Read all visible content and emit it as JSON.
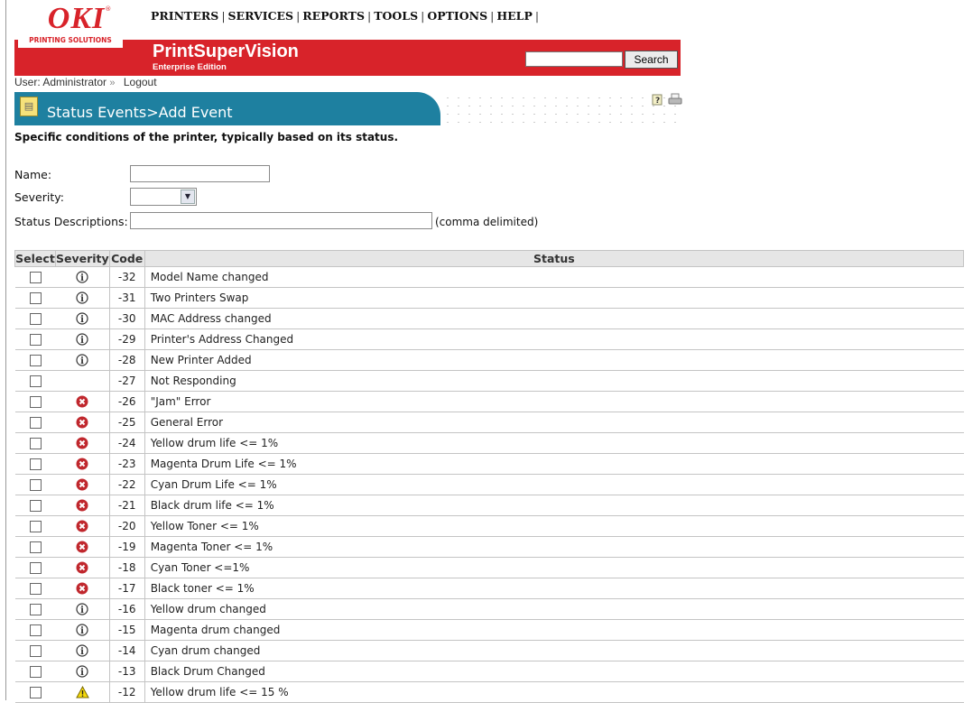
{
  "brand": {
    "logo": "OKI",
    "tagline": "PRINTING SOLUTIONS",
    "product": "PrintSuperVision",
    "edition": "Enterprise Edition",
    "accent": "#d8232a",
    "titlebar_color": "#1e80a0"
  },
  "nav": [
    "PRINTERS",
    "SERVICES",
    "REPORTS",
    "TOOLS",
    "OPTIONS",
    "HELP"
  ],
  "search": {
    "button_label": "Search",
    "value": ""
  },
  "user": {
    "label": "User: Administrator",
    "logout": "Logout"
  },
  "page": {
    "title": "Status Events>Add Event",
    "subtitle": "Specific conditions of the printer, typically based on its status."
  },
  "form": {
    "name_label": "Name:",
    "severity_label": "Severity:",
    "status_desc_label": "Status Descriptions:",
    "status_desc_hint": "(comma delimited)"
  },
  "table": {
    "headers": [
      "Select",
      "Severity",
      "Code",
      "Status"
    ],
    "rows": [
      {
        "severity": "info",
        "code": "-32",
        "status": "Model Name changed"
      },
      {
        "severity": "info",
        "code": "-31",
        "status": "Two Printers Swap"
      },
      {
        "severity": "info",
        "code": "-30",
        "status": "MAC Address changed"
      },
      {
        "severity": "info",
        "code": "-29",
        "status": "Printer's Address Changed"
      },
      {
        "severity": "info",
        "code": "-28",
        "status": "New Printer Added"
      },
      {
        "severity": "none",
        "code": "-27",
        "status": "Not Responding"
      },
      {
        "severity": "error",
        "code": "-26",
        "status": "\"Jam\" Error"
      },
      {
        "severity": "error",
        "code": "-25",
        "status": "General Error"
      },
      {
        "severity": "error",
        "code": "-24",
        "status": "Yellow drum life <= 1%"
      },
      {
        "severity": "error",
        "code": "-23",
        "status": "Magenta Drum Life <= 1%"
      },
      {
        "severity": "error",
        "code": "-22",
        "status": "Cyan Drum Life <= 1%"
      },
      {
        "severity": "error",
        "code": "-21",
        "status": "Black drum life <= 1%"
      },
      {
        "severity": "error",
        "code": "-20",
        "status": "Yellow Toner <= 1%"
      },
      {
        "severity": "error",
        "code": "-19",
        "status": "Magenta Toner <= 1%"
      },
      {
        "severity": "error",
        "code": "-18",
        "status": "Cyan Toner <=1%"
      },
      {
        "severity": "error",
        "code": "-17",
        "status": "Black toner <= 1%"
      },
      {
        "severity": "info",
        "code": "-16",
        "status": "Yellow drum changed"
      },
      {
        "severity": "info",
        "code": "-15",
        "status": "Magenta drum changed"
      },
      {
        "severity": "info",
        "code": "-14",
        "status": "Cyan drum changed"
      },
      {
        "severity": "info",
        "code": "-13",
        "status": "Black Drum Changed"
      },
      {
        "severity": "warning",
        "code": "-12",
        "status": "Yellow drum life <= 15 %"
      }
    ]
  }
}
